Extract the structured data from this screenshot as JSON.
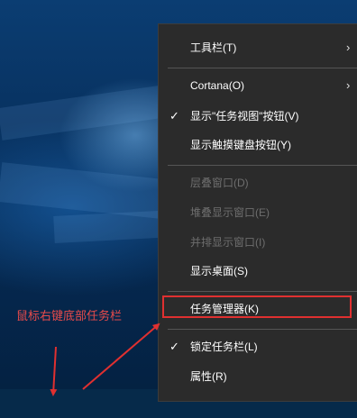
{
  "context_menu": {
    "items": [
      {
        "label": "工具栏(T)",
        "submenu": true
      },
      {
        "label": "Cortana(O)",
        "submenu": true
      },
      {
        "label": "显示\"任务视图\"按钮(V)",
        "checked": true
      },
      {
        "label": "显示触摸键盘按钮(Y)"
      },
      {
        "label": "层叠窗口(D)",
        "disabled": true
      },
      {
        "label": "堆叠显示窗口(E)",
        "disabled": true
      },
      {
        "label": "并排显示窗口(I)",
        "disabled": true
      },
      {
        "label": "显示桌面(S)"
      },
      {
        "label": "任务管理器(K)",
        "highlighted": true
      },
      {
        "label": "锁定任务栏(L)",
        "checked": true
      },
      {
        "label": "属性(R)"
      }
    ]
  },
  "annotation": {
    "text": "鼠标右键底部任务栏",
    "color": "#e84b4b"
  },
  "icons": {
    "check": "✓",
    "submenu_arrow": "›"
  },
  "colors": {
    "menu_background": "#2b2b2b",
    "highlight_border": "#e03030"
  }
}
